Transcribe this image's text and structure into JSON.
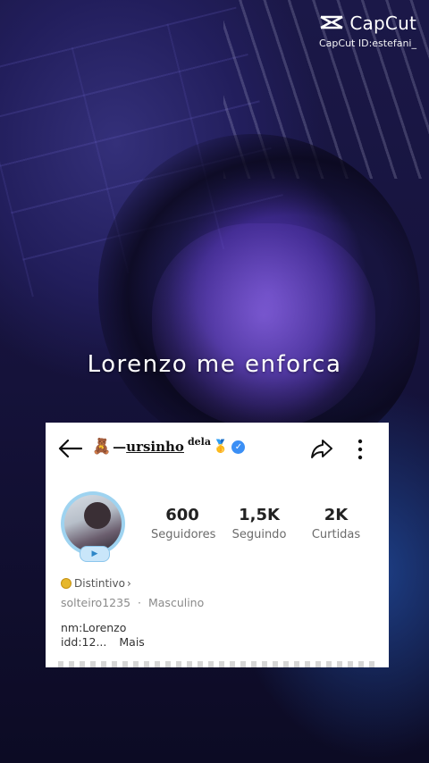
{
  "watermark": {
    "brand": "CapCut",
    "id_text": "CapCut ID:estefani_"
  },
  "caption": "Lorenzo me enforca",
  "profile": {
    "name": "ursinho",
    "name_dash": "—",
    "name_sup": "dela",
    "emoji_bear": "🧸",
    "emoji_medal": "🥇",
    "verified_mark": "✓",
    "avatar_badge": "▶",
    "stats": [
      {
        "value": "600",
        "label": "Seguidores"
      },
      {
        "value": "1,5K",
        "label": "Seguindo"
      },
      {
        "value": "2K",
        "label": "Curtidas"
      }
    ],
    "badge_label": "Distintivo",
    "badge_chevron": "›",
    "username": "solteiro1235",
    "separator": "·",
    "gender": "Masculino",
    "bio_line1": "nm:Lorenzo",
    "bio_line2": "idd:12...",
    "more_link": "Mais"
  },
  "colors": {
    "verified": "#3b8ff5",
    "avatar_ring": "#9ed3f0",
    "coin": "#e6b72c"
  }
}
